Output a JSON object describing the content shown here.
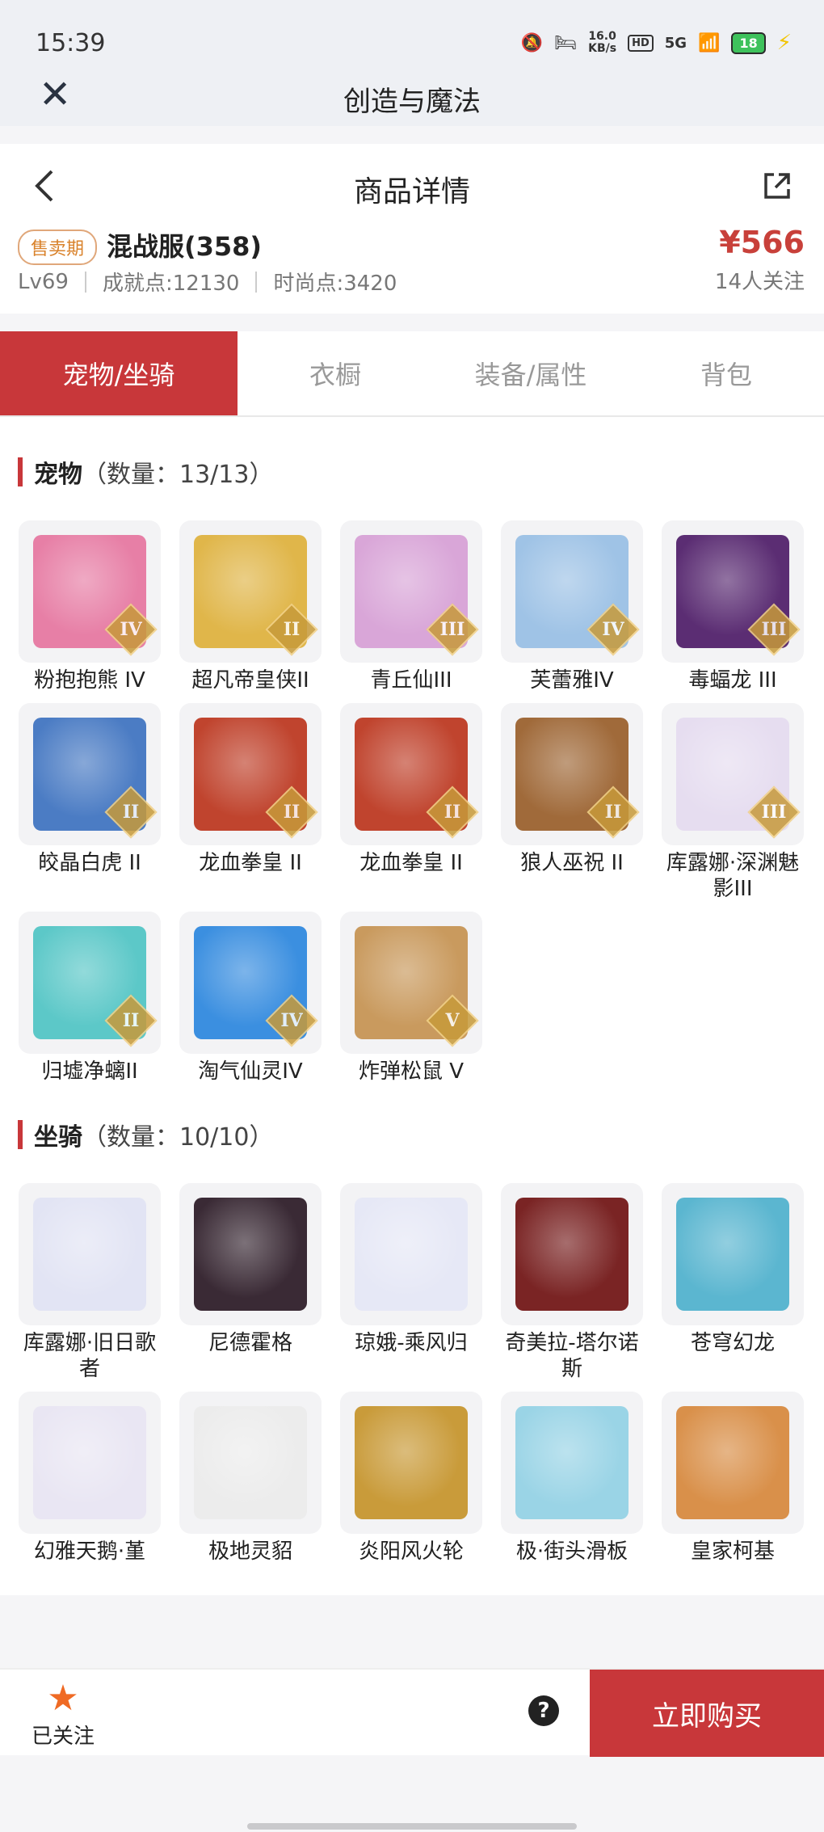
{
  "status": {
    "time": "15:39",
    "net_speed": "16.0",
    "net_unit": "KB/s",
    "hd": "HD",
    "signal": "5G",
    "battery": "18"
  },
  "app": {
    "title": "创造与魔法"
  },
  "page": {
    "title": "商品详情"
  },
  "product": {
    "sale_badge": "售卖期",
    "server": "混战服(358)",
    "level": "Lv69",
    "achievement": "成就点:12130",
    "fashion": "时尚点:3420",
    "price": "¥566",
    "followers": "14人关注"
  },
  "tabs": [
    {
      "label": "宠物/坐骑"
    },
    {
      "label": "衣橱"
    },
    {
      "label": "装备/属性"
    },
    {
      "label": "背包"
    }
  ],
  "pets": {
    "title": "宠物",
    "count": "（数量：13/13）",
    "items": [
      {
        "name": "粉抱抱熊 IV",
        "tier": "IV",
        "color": "#e77fa6"
      },
      {
        "name": "超凡帝皇侠II",
        "tier": "II",
        "color": "#e0b64a"
      },
      {
        "name": "青丘仙III",
        "tier": "III",
        "color": "#d9a6d8"
      },
      {
        "name": "芙蕾雅IV",
        "tier": "IV",
        "color": "#9fc3e6"
      },
      {
        "name": "毒蝠龙 III",
        "tier": "III",
        "color": "#5b2d73"
      },
      {
        "name": "皎晶白虎 II",
        "tier": "II",
        "color": "#4b7cc4"
      },
      {
        "name": "龙血拳皇 II",
        "tier": "II",
        "color": "#c0442e"
      },
      {
        "name": "龙血拳皇 II",
        "tier": "II",
        "color": "#c0442e"
      },
      {
        "name": "狼人巫祝 II",
        "tier": "II",
        "color": "#a06a3a"
      },
      {
        "name": "库露娜·深渊魅影III",
        "tier": "III",
        "color": "#e6ddf0"
      },
      {
        "name": "归墟净螭II",
        "tier": "II",
        "color": "#5cc8c8"
      },
      {
        "name": "淘气仙灵IV",
        "tier": "IV",
        "color": "#3b8fe0"
      },
      {
        "name": "炸弹松鼠 V",
        "tier": "V",
        "color": "#c99a5e"
      }
    ]
  },
  "mounts": {
    "title": "坐骑",
    "count": "（数量：10/10）",
    "items": [
      {
        "name": "库露娜·旧日歌者",
        "color": "#e2e4f4"
      },
      {
        "name": "尼德霍格",
        "color": "#3a2a35"
      },
      {
        "name": "琼娥-乘风归",
        "color": "#e6e8f6"
      },
      {
        "name": "奇美拉-塔尔诺斯",
        "color": "#7a2424"
      },
      {
        "name": "苍穹幻龙",
        "color": "#5bb6d0"
      },
      {
        "name": "幻雅天鹅·堇",
        "color": "#e9e6f3"
      },
      {
        "name": "极地灵貂",
        "color": "#ececec"
      },
      {
        "name": "炎阳风火轮",
        "color": "#c99b3a"
      },
      {
        "name": "极·街头滑板",
        "color": "#9ad4e6"
      },
      {
        "name": "皇家柯基",
        "color": "#d9904a"
      }
    ]
  },
  "bottom": {
    "follow_label": "已关注",
    "help": "?",
    "buy_label": "立即购买"
  }
}
